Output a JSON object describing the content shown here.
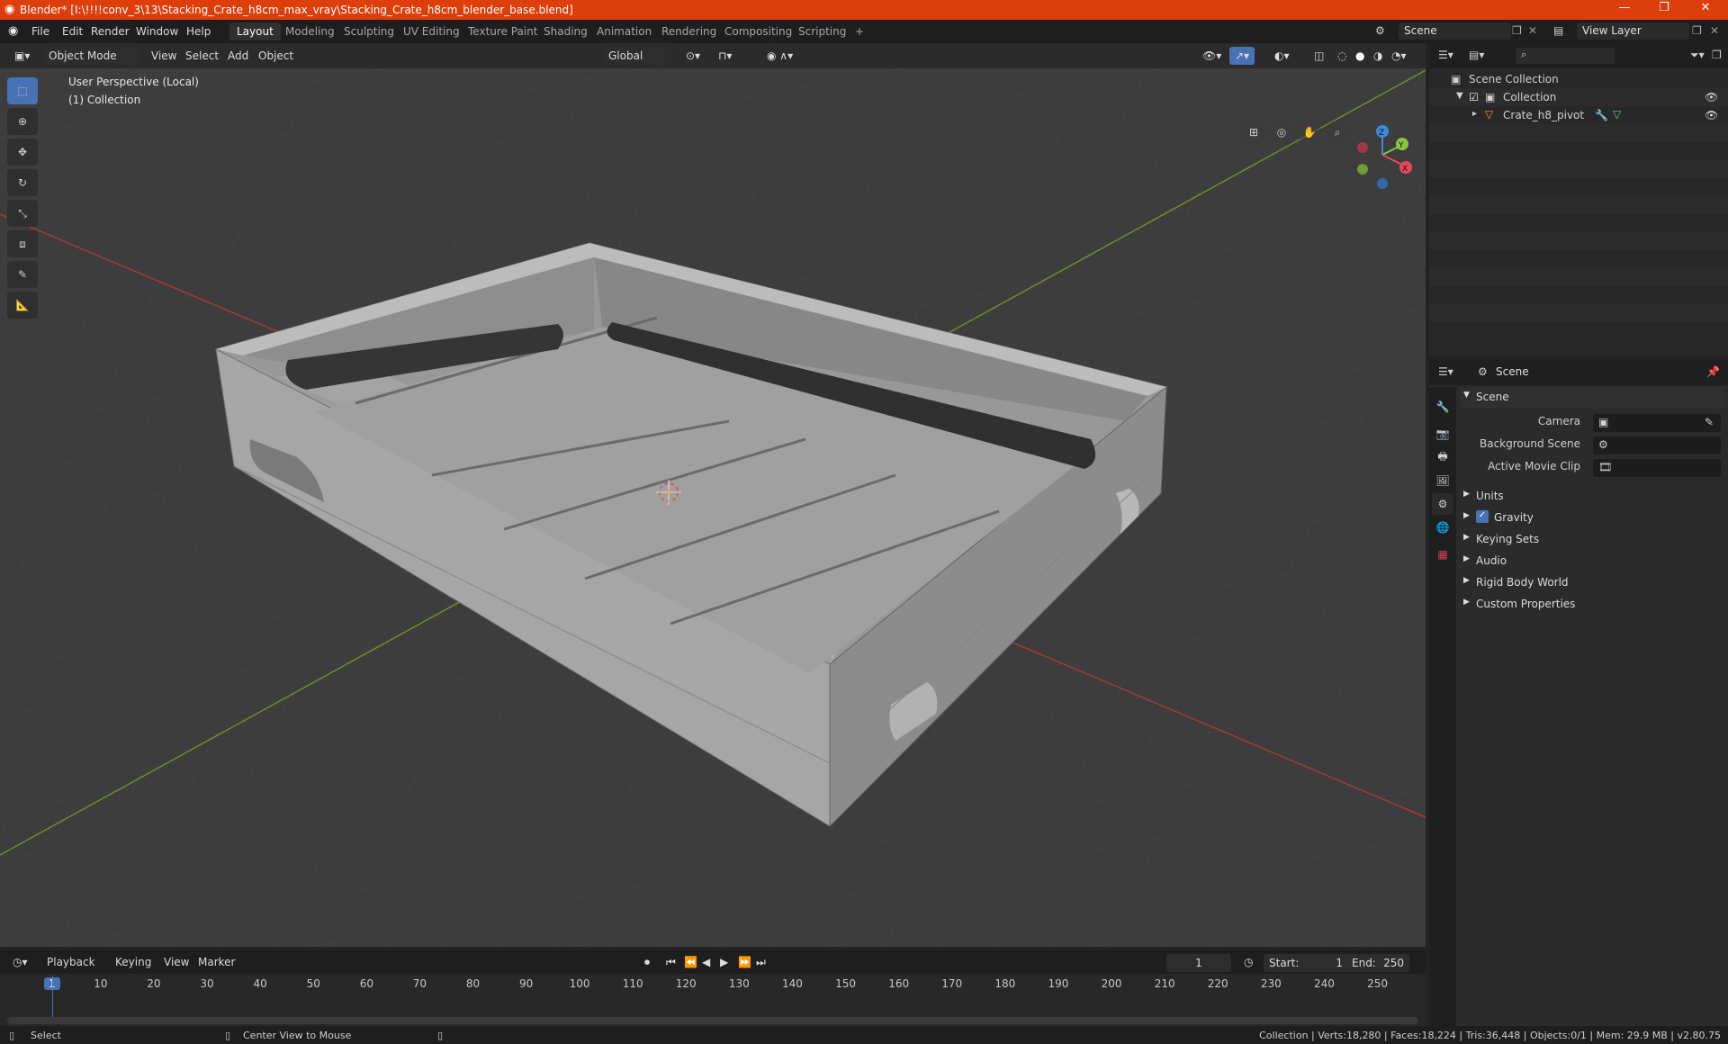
{
  "window": {
    "title": "Blender* [I:\\!!!!conv_3\\13\\Stacking_Crate_h8cm_max_vray\\Stacking_Crate_h8cm_blender_base.blend]",
    "controls": [
      "—",
      "❐",
      "✕"
    ]
  },
  "menu": [
    "File",
    "Edit",
    "Render",
    "Window",
    "Help"
  ],
  "workspaces": [
    "Layout",
    "Modeling",
    "Sculpting",
    "UV Editing",
    "Texture Paint",
    "Shading",
    "Animation",
    "Rendering",
    "Compositing",
    "Scripting"
  ],
  "workspace_add": "+",
  "scene_name": "Scene",
  "view_layer": "View Layer",
  "viewport_header": {
    "mode": "Object Mode",
    "menus": [
      "View",
      "Select",
      "Add",
      "Object"
    ],
    "orientation": "Global"
  },
  "viewport": {
    "perspective": "User Perspective (Local)",
    "collection": "(1) Collection",
    "gizmo_axes": [
      "Z",
      "Y",
      "X"
    ]
  },
  "outliner": {
    "search_placeholder": "",
    "items": [
      {
        "label": "Scene Collection"
      },
      {
        "label": "Collection"
      },
      {
        "label": "Crate_h8_pivot"
      }
    ]
  },
  "properties": {
    "context": "Scene",
    "section": "Scene",
    "fields": [
      {
        "label": "Camera"
      },
      {
        "label": "Background Scene"
      },
      {
        "label": "Active Movie Clip"
      }
    ],
    "panels": [
      "Units",
      "Gravity",
      "Keying Sets",
      "Audio",
      "Rigid Body World",
      "Custom Properties"
    ],
    "gravity_checked": true
  },
  "timeline": {
    "menus": [
      "Playback",
      "Keying",
      "View",
      "Marker"
    ],
    "current_frame": "1",
    "start_label": "Start:",
    "start": "1",
    "end_label": "End:",
    "end": "250",
    "ticks": [
      "1",
      "10",
      "20",
      "30",
      "40",
      "50",
      "60",
      "70",
      "80",
      "90",
      "100",
      "110",
      "120",
      "130",
      "140",
      "150",
      "160",
      "170",
      "180",
      "190",
      "200",
      "210",
      "220",
      "230",
      "240",
      "250"
    ]
  },
  "statusbar": {
    "left": "Select",
    "middle": "Center View to Mouse",
    "right": "Collection | Verts:18,280 | Faces:18,224 | Tris:36,448 | Objects:0/1 | Mem: 29.9 MB | v2.80.75"
  },
  "colors": {
    "titlebar": "#dd3f0c",
    "accent": "#4772b3",
    "x_axis": "#e5475a",
    "y_axis": "#8cc43e",
    "z_axis": "#3d8ad9"
  }
}
